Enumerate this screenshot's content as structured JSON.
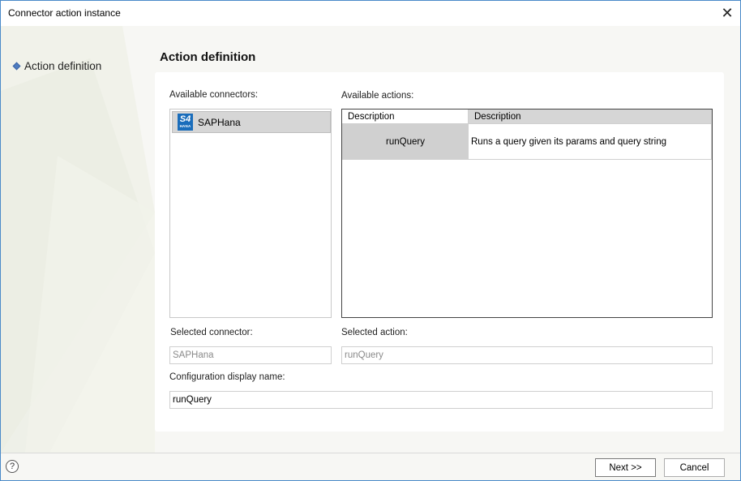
{
  "window": {
    "title": "Connector action instance",
    "close_glyph": "✕"
  },
  "nav": {
    "items": [
      {
        "label": "Action definition",
        "icon": "diamond-bullet-icon"
      }
    ]
  },
  "main": {
    "title": "Action definition",
    "available_connectors_label": "Available connectors:",
    "connectors": [
      {
        "name": "SAPHana",
        "icon": "s4-hana-icon",
        "icon_text_big": "S4",
        "icon_text_small": "HANA",
        "selected": true
      }
    ],
    "available_actions_label": "Available actions:",
    "actions_table": {
      "columns": [
        "Description",
        "Description"
      ],
      "rows": [
        {
          "name": "runQuery",
          "description": "Runs a query given its params and query string"
        }
      ]
    },
    "selected_connector_label": "Selected connector:",
    "selected_connector_value": "SAPHana",
    "selected_action_label": "Selected action:",
    "selected_action_value": "runQuery",
    "config_display_name_label": "Configuration display name:",
    "config_display_name_value": "runQuery"
  },
  "footer": {
    "help_glyph": "?",
    "next_label": "Next >>",
    "cancel_label": "Cancel"
  },
  "colors": {
    "window_border": "#4a8ac9",
    "selection_gray": "#d6d6d6",
    "s4_icon_blue": "#1a6dbb",
    "nav_bullet": "#4e7cc0"
  }
}
